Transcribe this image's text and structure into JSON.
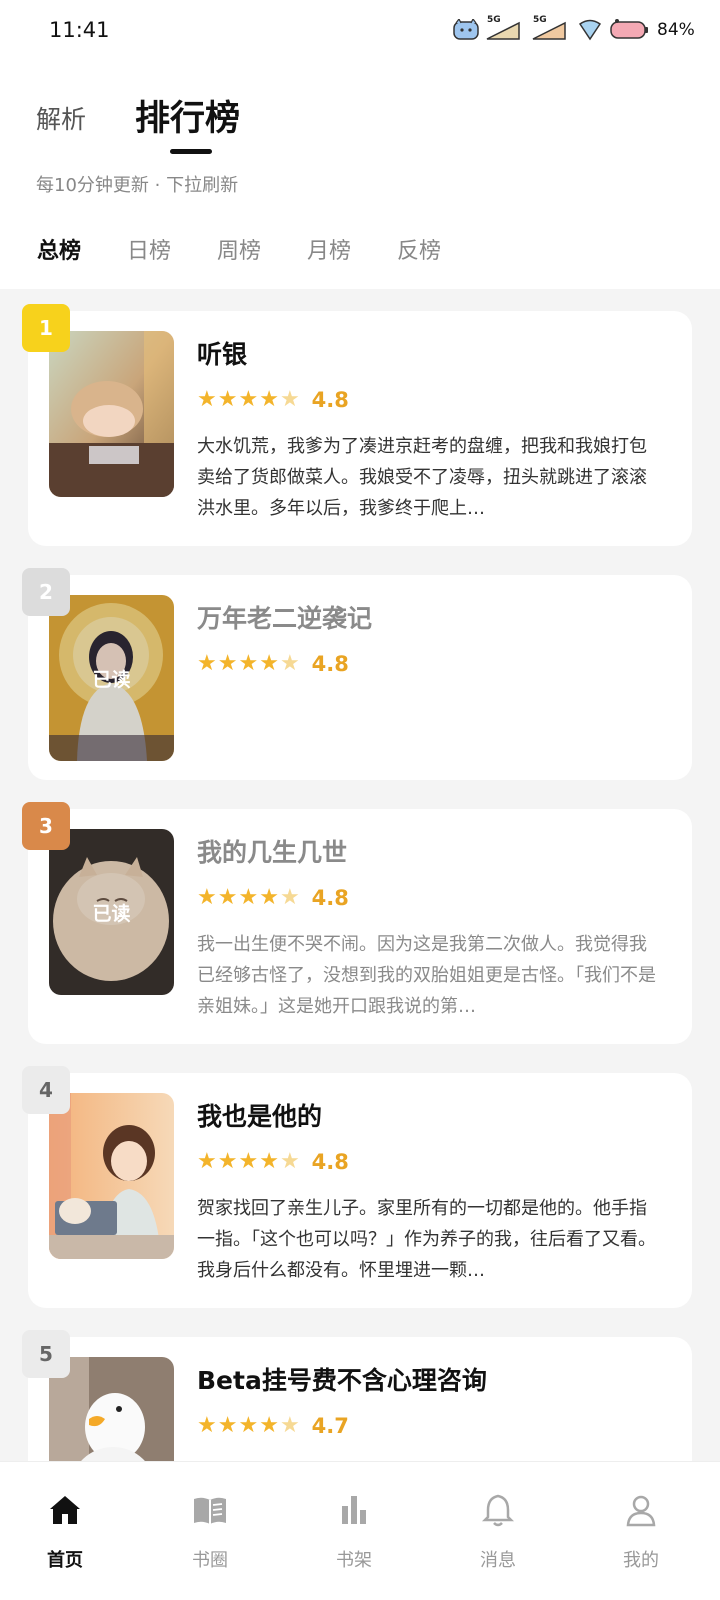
{
  "status": {
    "time": "11:41",
    "battery": "84%"
  },
  "header": {
    "tab_parse": "解析",
    "tab_rank": "排行榜",
    "update_note": "每10分钟更新 · 下拉刷新"
  },
  "sub_tabs": [
    {
      "label": "总榜",
      "active": true
    },
    {
      "label": "日榜",
      "active": false
    },
    {
      "label": "周榜",
      "active": false
    },
    {
      "label": "月榜",
      "active": false
    },
    {
      "label": "反榜",
      "active": false
    }
  ],
  "books": [
    {
      "rank": "1",
      "title": "听银",
      "rating": "4.8",
      "stars": 4,
      "read": false,
      "read_label": "",
      "synopsis": "大水饥荒，我爹为了凑进京赶考的盘缠，把我和我娘打包卖给了货郎做菜人。我娘受不了凌辱，扭头就跳进了滚滚洪水里。多年以后，我爹终于爬上…"
    },
    {
      "rank": "2",
      "title": "万年老二逆袭记",
      "rating": "4.8",
      "stars": 4,
      "read": true,
      "read_label": "已读",
      "synopsis": ""
    },
    {
      "rank": "3",
      "title": "我的几生几世",
      "rating": "4.8",
      "stars": 4,
      "read": true,
      "read_label": "已读",
      "synopsis": "我一出生便不哭不闹。因为这是我第二次做人。我觉得我已经够古怪了，没想到我的双胎姐姐更是古怪。「我们不是亲姐妹。」这是她开口跟我说的第…"
    },
    {
      "rank": "4",
      "title": "我也是他的",
      "rating": "4.8",
      "stars": 4,
      "read": false,
      "read_label": "",
      "synopsis": "贺家找回了亲生儿子。家里所有的一切都是他的。他手指一指。「这个也可以吗？」作为养子的我，往后看了又看。我身后什么都没有。怀里埋进一颗…"
    },
    {
      "rank": "5",
      "title": "Beta挂号费不含心理咨询",
      "rating": "4.7",
      "stars": 4,
      "read": false,
      "read_label": "",
      "synopsis": ""
    }
  ],
  "badge_colors": {
    "rank1": "#f7d21c",
    "rank2": "#dcdcdc",
    "rank3": "#d9894a",
    "rank_default": "#ebebeb"
  },
  "covers": {
    "book1": "anime-girl-sleeping-at-window",
    "book2": "anime-girl-praying-golden-halo",
    "book3": "fluffy-cream-cat",
    "book4": "girl-with-laptop-and-cat",
    "book5": "white-duck"
  },
  "bottom_nav": [
    {
      "label": "首页",
      "icon": "home-icon",
      "active": true
    },
    {
      "label": "书圈",
      "icon": "book-circle-icon",
      "active": false
    },
    {
      "label": "书架",
      "icon": "bookshelf-icon",
      "active": false
    },
    {
      "label": "消息",
      "icon": "bell-icon",
      "active": false
    },
    {
      "label": "我的",
      "icon": "profile-icon",
      "active": false
    }
  ]
}
